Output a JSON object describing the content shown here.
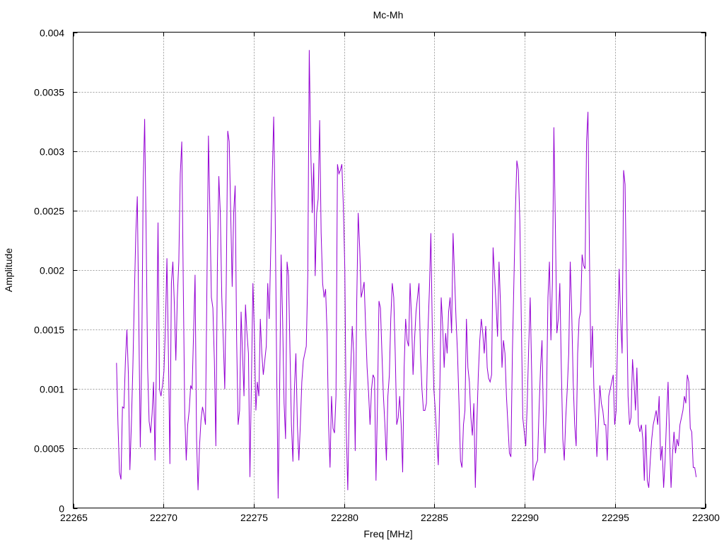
{
  "chart_data": {
    "type": "line",
    "title": "Mc-Mh",
    "xlabel": "Freq [MHz]",
    "ylabel": "Amplitude",
    "xlim": [
      22265,
      22300
    ],
    "ylim": [
      0,
      0.004
    ],
    "grid": true,
    "x_ticks": [
      22265,
      22270,
      22275,
      22280,
      22285,
      22290,
      22295,
      22300
    ],
    "x_tick_labels": [
      "22265",
      "22270",
      "22275",
      "22280",
      "22285",
      "22290",
      "22295",
      "22300"
    ],
    "y_ticks": [
      0,
      0.0005,
      0.001,
      0.0015,
      0.002,
      0.0025,
      0.003,
      0.0035,
      0.004
    ],
    "y_tick_labels": [
      "0",
      "0.0005",
      "0.001",
      "0.0015",
      "0.002",
      "0.0025",
      "0.003",
      "0.0035",
      "0.004"
    ],
    "series": [
      {
        "name": "Mc-Mh",
        "color": "#9400d3",
        "x_range": [
          22267.4,
          22299.5
        ],
        "values": [
          0.00122,
          0.0007,
          0.0003,
          0.00024,
          0.00085,
          0.00084,
          0.00124,
          0.0015,
          0.00112,
          0.00032,
          0.0007,
          0.00118,
          0.00177,
          0.00231,
          0.00262,
          0.00159,
          0.00051,
          0.0013,
          0.00272,
          0.00327,
          0.00231,
          0.00118,
          0.00073,
          0.00063,
          0.00079,
          0.00106,
          0.0004,
          0.0013,
          0.0024,
          0.001,
          0.00094,
          0.00103,
          0.00115,
          0.00153,
          0.0021,
          0.0013,
          0.00037,
          0.00189,
          0.00207,
          0.00171,
          0.00124,
          0.00177,
          0.00207,
          0.00281,
          0.00308,
          0.00189,
          0.00079,
          0.0004,
          0.0007,
          0.00082,
          0.00103,
          0.001,
          0.00147,
          0.00196,
          0.00058,
          0.00015,
          0.00052,
          0.00074,
          0.00085,
          0.00079,
          0.0007,
          0.00189,
          0.00313,
          0.00248,
          0.00177,
          0.00168,
          0.00124,
          0.00052,
          0.00201,
          0.00279,
          0.00248,
          0.00177,
          0.00141,
          0.001,
          0.00189,
          0.00317,
          0.00308,
          0.00248,
          0.00186,
          0.00248,
          0.00271,
          0.00141,
          0.0007,
          0.00082,
          0.00165,
          0.0013,
          0.00094,
          0.00171,
          0.00147,
          0.0013,
          0.00026,
          0.00106,
          0.00189,
          0.00147,
          0.00082,
          0.00106,
          0.00094,
          0.00159,
          0.0013,
          0.00112,
          0.00124,
          0.00136,
          0.00189,
          0.00159,
          0.00216,
          0.00278,
          0.00329,
          0.00248,
          0.00118,
          8e-05,
          0.001,
          0.00213,
          0.00159,
          0.00088,
          0.00058,
          0.00207,
          0.00195,
          0.0013,
          0.0007,
          0.00039,
          0.001,
          0.0013,
          0.0007,
          0.0004,
          0.0007,
          0.00106,
          0.00124,
          0.0013,
          0.00136,
          0.00195,
          0.00385,
          0.00302,
          0.00248,
          0.0029,
          0.00195,
          0.00248,
          0.0026,
          0.00326,
          0.00231,
          0.00189,
          0.00177,
          0.00184,
          0.00147,
          0.0007,
          0.00034,
          0.00094,
          0.00067,
          0.00063,
          0.00094,
          0.00289,
          0.00281,
          0.00284,
          0.00289,
          0.00254,
          0.00201,
          0.00064,
          0.00015,
          0.00088,
          0.00118,
          0.00153,
          0.0013,
          0.00048,
          0.00171,
          0.00248,
          0.00219,
          0.00177,
          0.00183,
          0.0019,
          0.00153,
          0.00118,
          0.00097,
          0.0007,
          0.001,
          0.00112,
          0.00109,
          0.00023,
          0.00088,
          0.00174,
          0.00168,
          0.0013,
          0.00094,
          0.0007,
          0.0004,
          0.00094,
          0.00112,
          0.00159,
          0.00189,
          0.00177,
          0.0013,
          0.0007,
          0.00076,
          0.00094,
          0.0007,
          0.0003,
          0.00118,
          0.00159,
          0.00141,
          0.00136,
          0.00189,
          0.00159,
          0.00112,
          0.00141,
          0.00165,
          0.00177,
          0.00189,
          0.0013,
          0.001,
          0.00082,
          0.00082,
          0.00088,
          0.00147,
          0.00183,
          0.00231,
          0.00147,
          0.001,
          0.00082,
          0.00058,
          0.00036,
          0.00094,
          0.00177,
          0.00153,
          0.00118,
          0.00147,
          0.0013,
          0.00165,
          0.00177,
          0.00147,
          0.00231,
          0.00195,
          0.00159,
          0.0013,
          0.00088,
          0.0004,
          0.00034,
          0.0007,
          0.00082,
          0.00159,
          0.00118,
          0.00106,
          0.00076,
          0.00061,
          0.00088,
          0.00017,
          0.0007,
          0.00112,
          0.00141,
          0.00159,
          0.00147,
          0.0013,
          0.00153,
          0.00118,
          0.00109,
          0.00106,
          0.00112,
          0.00219,
          0.00195,
          0.00171,
          0.00144,
          0.00207,
          0.00171,
          0.00118,
          0.00141,
          0.0013,
          0.00094,
          0.0007,
          0.00046,
          0.00043,
          0.0013,
          0.00189,
          0.00248,
          0.00292,
          0.00284,
          0.00242,
          0.00159,
          0.00076,
          0.00064,
          0.00052,
          0.00088,
          0.00136,
          0.00177,
          0.00112,
          0.00023,
          0.00032,
          0.00037,
          0.0004,
          0.00082,
          0.00118,
          0.00141,
          0.0007,
          0.00046,
          0.00088,
          0.00177,
          0.00207,
          0.00141,
          0.00189,
          0.0032,
          0.00237,
          0.00147,
          0.00159,
          0.00189,
          0.00118,
          0.00058,
          0.0004,
          0.00076,
          0.001,
          0.0013,
          0.00207,
          0.00165,
          0.00106,
          0.0007,
          0.00052,
          0.0013,
          0.00159,
          0.00165,
          0.00213,
          0.00204,
          0.00201,
          0.00308,
          0.00333,
          0.00213,
          0.00118,
          0.00153,
          0.001,
          0.00076,
          0.00043,
          0.0007,
          0.00103,
          0.00088,
          0.00082,
          0.0007,
          0.0007,
          0.0004,
          0.00094,
          0.001,
          0.00106,
          0.00112,
          0.0007,
          0.00082,
          0.00147,
          0.00201,
          0.00159,
          0.0013,
          0.00284,
          0.00272,
          0.00177,
          0.00094,
          0.0007,
          0.00076,
          0.00125,
          0.00106,
          0.00082,
          0.00118,
          0.0007,
          0.00064,
          0.0007,
          0.00058,
          0.00023,
          0.0007,
          0.00023,
          0.00017,
          0.0004,
          0.00058,
          0.0007,
          0.00076,
          0.00082,
          0.0007,
          0.00094,
          0.0004,
          0.00052,
          0.00017,
          0.0004,
          0.00076,
          0.00106,
          0.00058,
          0.00017,
          0.00046,
          0.00064,
          0.00046,
          0.00058,
          0.00052,
          0.0007,
          0.00076,
          0.00082,
          0.00094,
          0.00088,
          0.00112,
          0.00106,
          0.00067,
          0.00064,
          0.00034,
          0.00034,
          0.00026
        ]
      }
    ]
  }
}
